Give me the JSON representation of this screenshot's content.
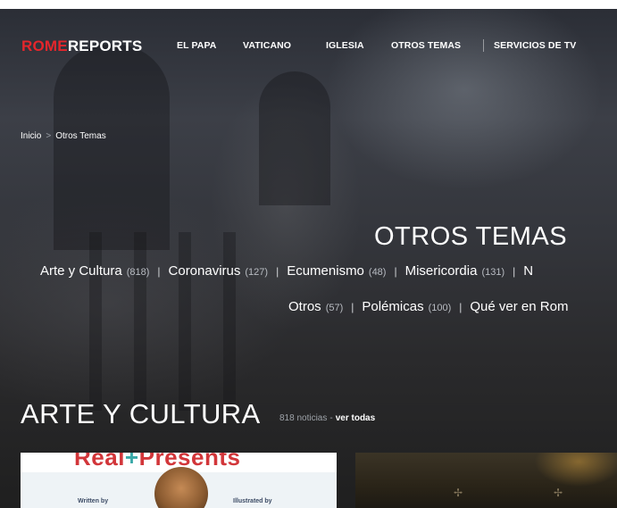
{
  "brand": {
    "part1": "ROME",
    "part2": "REPORTS"
  },
  "nav": {
    "items": [
      "EL PAPA",
      "VATICANO",
      "IGLESIA",
      "OTROS TEMAS",
      "SERVICIOS DE TV"
    ]
  },
  "breadcrumb": {
    "home": "Inicio",
    "separator": ">",
    "current": "Otros Temas"
  },
  "page": {
    "title": "OTROS TEMAS"
  },
  "categories": {
    "row1": [
      {
        "name": "Arte y Cultura",
        "count": "(818)"
      },
      {
        "name": "Coronavirus",
        "count": "(127)"
      },
      {
        "name": "Ecumenismo",
        "count": "(48)"
      },
      {
        "name": "Misericordia",
        "count": "(131)"
      }
    ],
    "row1_trailing": "N",
    "row2": [
      {
        "name": "Otros",
        "count": "(57)"
      },
      {
        "name": "Polémicas",
        "count": "(100)"
      }
    ],
    "row2_trailing": "Qué ver en Rom",
    "separator": "|"
  },
  "section": {
    "title": "ARTE Y CULTURA",
    "count_text": "818 noticias",
    "dash": "-",
    "view_all": "ver todas"
  },
  "cards": {
    "card1": {
      "book_title_a": "Real",
      "book_title_b": "Presents",
      "credit_left": "Written by",
      "credit_right": "Illustrated by"
    }
  },
  "colors": {
    "brand_red": "#e4262c",
    "text": "#ffffff",
    "muted": "#b8bcc2"
  }
}
